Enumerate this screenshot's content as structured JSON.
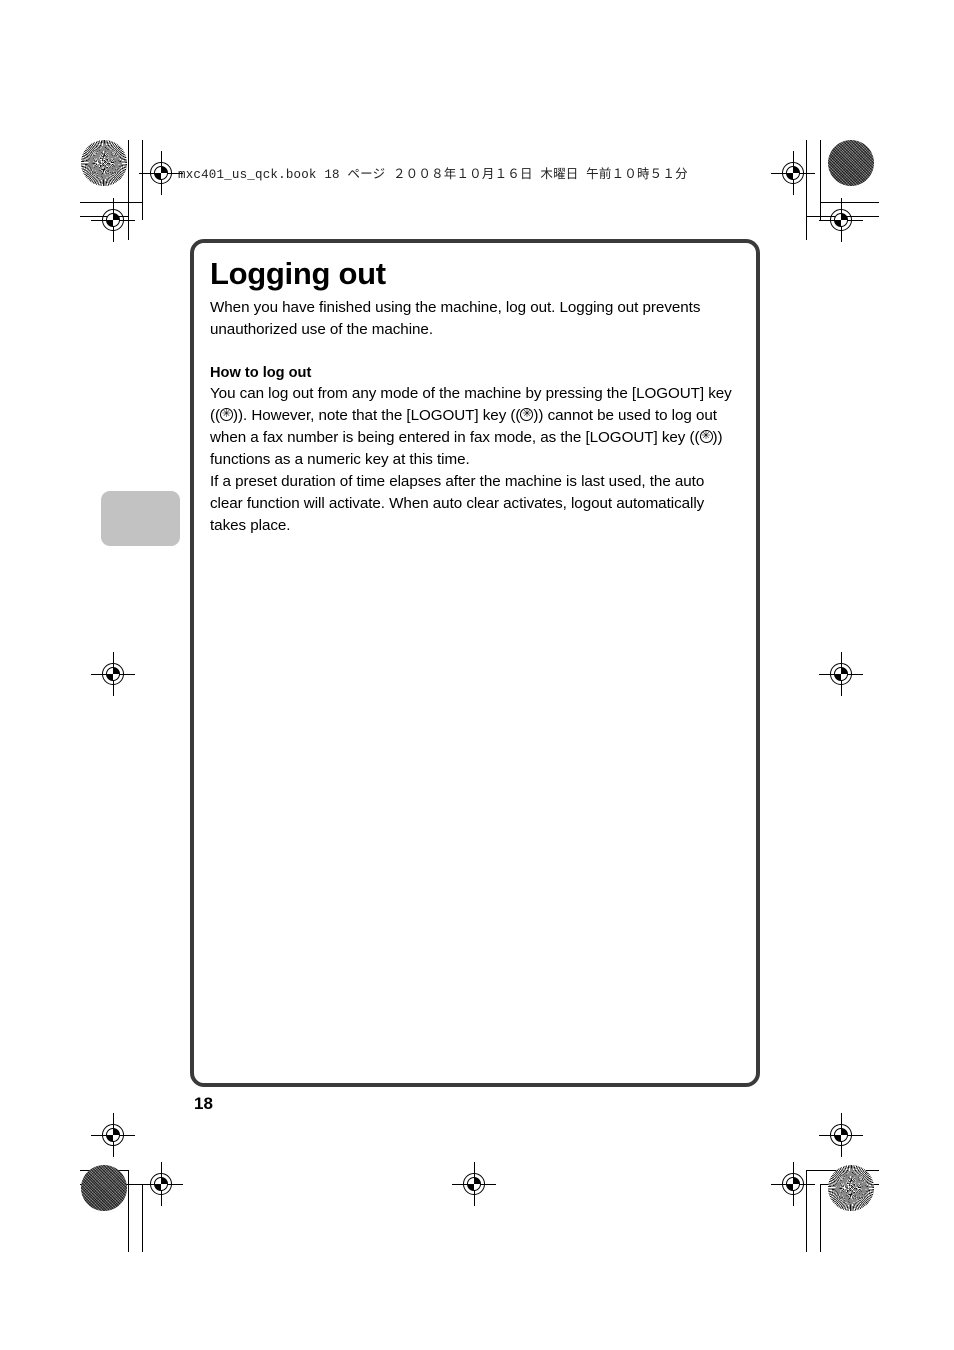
{
  "print_header": {
    "text": "mxc401_us_qck.book   18 ページ   ２００８年１０月１６日   木曜日   午前１０時５１分"
  },
  "page": {
    "number": "18"
  },
  "content": {
    "title": "Logging out",
    "intro": "When you have finished using the machine, log out. Logging out prevents unauthorized use of the machine.",
    "subhead": "How to log out",
    "paragraph_1_part_1": "You can log out from any mode of the machine by pressing the [LOGOUT] key ((",
    "paragraph_1_part_2": ")). However, note that the [LOGOUT] key ((",
    "paragraph_1_part_3": ")) cannot be used to log out when a fax number is being entered in fax mode, as the [LOGOUT] key ((",
    "paragraph_1_part_4": ")) functions as a numeric key at this time.",
    "paragraph_2": "If a preset duration of time elapses after the machine is last used, the auto clear function will activate. When auto clear activates, logout automatically takes place.",
    "key_symbol": "✳"
  },
  "marks": {
    "side_tab_color": "#c2c2c2",
    "box_border_color": "#3a3a3a",
    "registration_label": "registration-target",
    "crop_label": "crop-mark"
  }
}
